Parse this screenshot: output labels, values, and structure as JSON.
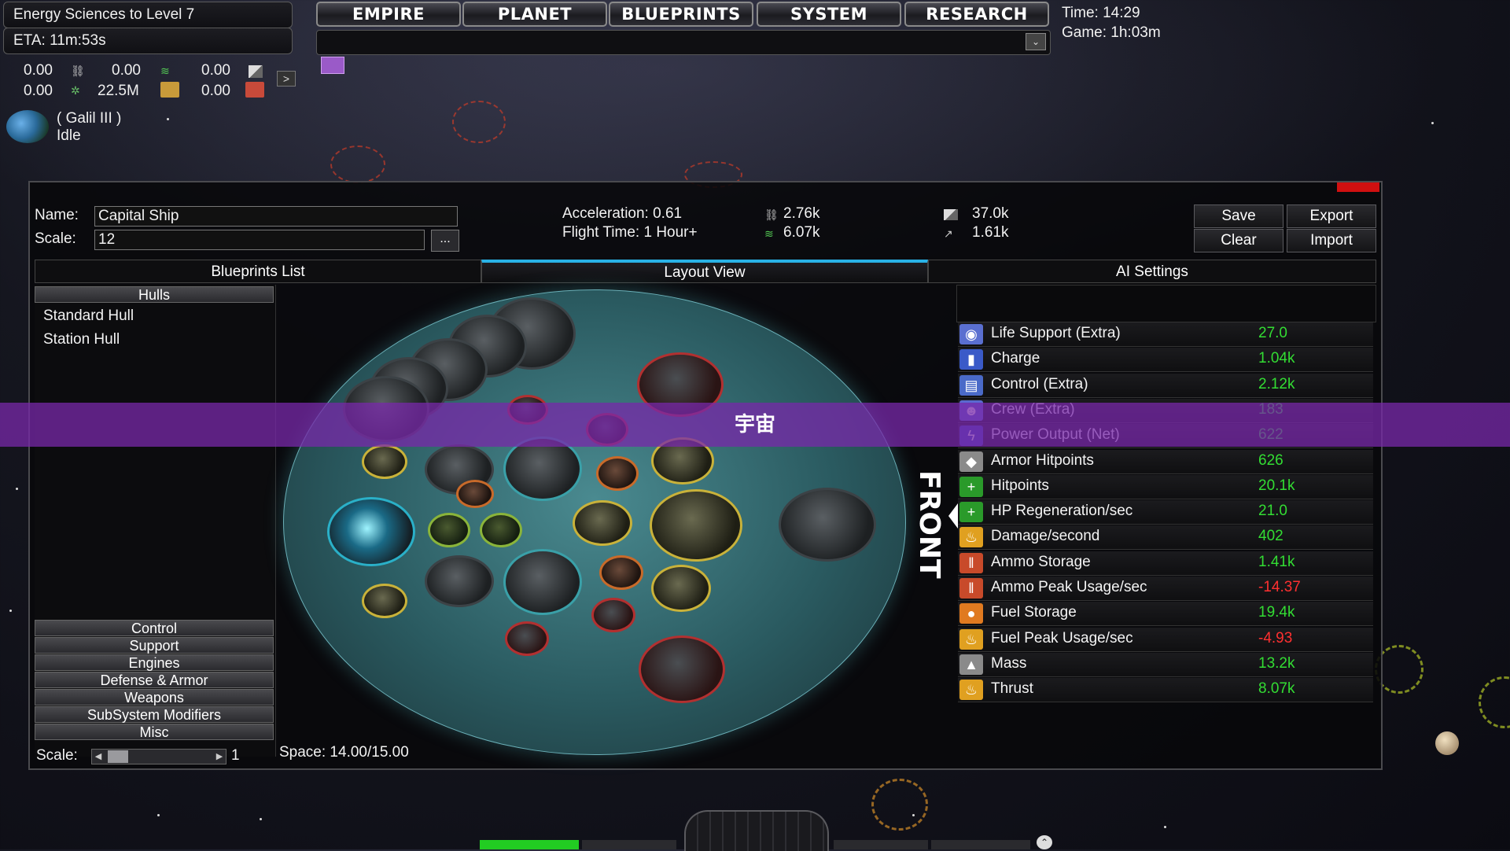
{
  "research": {
    "title": "Energy Sciences to Level 7",
    "eta": "ETA: 11m:53s"
  },
  "nav": {
    "items": [
      "EMPIRE",
      "PLANET",
      "BLUEPRINTS",
      "SYSTEM",
      "RESEARCH"
    ]
  },
  "clock": {
    "time": "Time: 14:29",
    "game": "Game: 1h:03m"
  },
  "resources": {
    "r1": "0.00",
    "r2": "0.00",
    "r3": "0.00",
    "r4": "0.00",
    "r5": "22.5M",
    "r6": "0.00",
    "expand_label": ">"
  },
  "planet": {
    "name": "( Galil III )",
    "status": "Idle"
  },
  "blueprint": {
    "name_label": "Name:",
    "name_value": "Capital Ship",
    "scale_label": "Scale:",
    "scale_value": "12",
    "browse_label": "...",
    "acceleration": "Acceleration: 0.61",
    "flight_time": "Flight Time: 1 Hour+",
    "stat_a": "2.76k",
    "stat_b": "6.07k",
    "stat_c": "37.0k",
    "stat_d": "1.61k",
    "save": "Save",
    "export": "Export",
    "clear": "Clear",
    "import": "Import"
  },
  "tabs": [
    "Blueprints List",
    "Layout View",
    "AI Settings"
  ],
  "hulls": {
    "header": "Hulls",
    "items": [
      "Standard Hull",
      "Station Hull"
    ]
  },
  "categories": [
    "Control",
    "Support",
    "Engines",
    "Defense & Armor",
    "Weapons",
    "SubSystem Modifiers",
    "Misc"
  ],
  "scale_slider": {
    "label": "Scale:",
    "value": "1"
  },
  "space": "Space: 14.00/15.00",
  "front_label": "FRONT",
  "stats": [
    {
      "name": "Life Support (Extra)",
      "value": "27.0",
      "icon": "life-support-icon",
      "color": "#5a6fd0"
    },
    {
      "name": "Charge",
      "value": "1.04k",
      "icon": "battery-icon",
      "color": "#3a5ac8"
    },
    {
      "name": "Control (Extra)",
      "value": "2.12k",
      "icon": "control-icon",
      "color": "#4a6ac8"
    },
    {
      "name": "Crew (Extra)",
      "value": "183",
      "icon": "crew-icon",
      "color": "#5a6ad0"
    },
    {
      "name": "Power Output (Net)",
      "value": "622",
      "icon": "power-icon",
      "color": "#3a4ab8"
    },
    {
      "name": "Armor Hitpoints",
      "value": "626",
      "icon": "armor-icon",
      "color": "#8a8a8a"
    },
    {
      "name": "Hitpoints",
      "value": "20.1k",
      "icon": "plus-icon",
      "color": "#2a9a2a"
    },
    {
      "name": "HP Regeneration/sec",
      "value": "21.0",
      "icon": "plus-icon",
      "color": "#2a9a2a"
    },
    {
      "name": "Damage/second",
      "value": "402",
      "icon": "fire-icon",
      "color": "#e0a020"
    },
    {
      "name": "Ammo Storage",
      "value": "1.41k",
      "icon": "ammo-icon",
      "color": "#c84a2a"
    },
    {
      "name": "Ammo Peak Usage/sec",
      "value": "-14.37",
      "icon": "ammo-icon",
      "color": "#c84a2a"
    },
    {
      "name": "Fuel Storage",
      "value": "19.4k",
      "icon": "fuel-icon",
      "color": "#e07a20"
    },
    {
      "name": "Fuel Peak Usage/sec",
      "value": "-4.93",
      "icon": "fire-icon",
      "color": "#e0a020"
    },
    {
      "name": "Mass",
      "value": "13.2k",
      "icon": "mass-icon",
      "color": "#8a8a8a"
    },
    {
      "name": "Thrust",
      "value": "8.07k",
      "icon": "thrust-icon",
      "color": "#e0a020"
    }
  ],
  "banner": "宇宙"
}
